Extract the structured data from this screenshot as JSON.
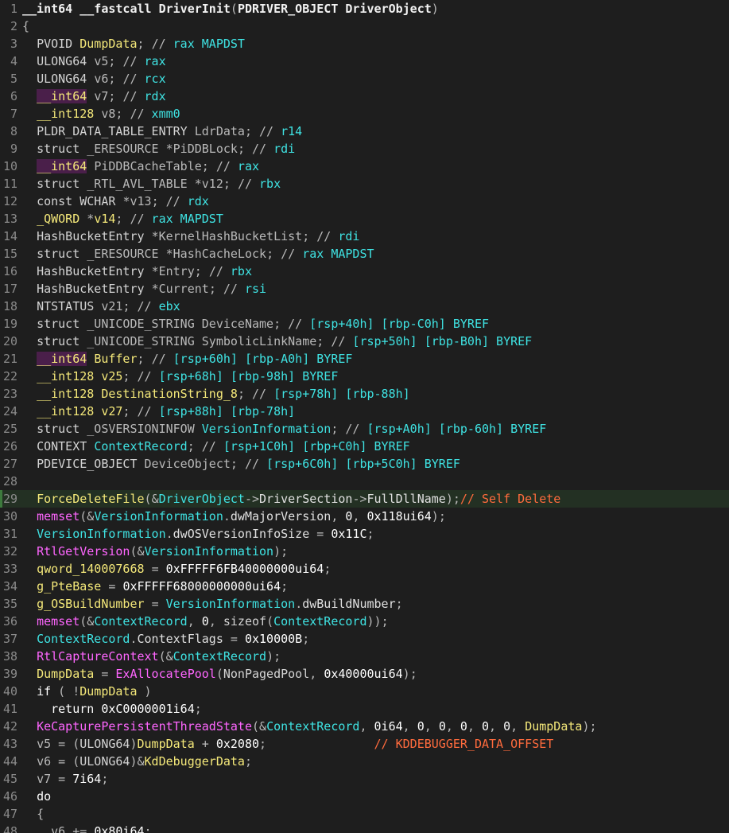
{
  "editor": {
    "colors": {
      "background": "#1e1e1e",
      "line_number": "#8a8a8a",
      "comment": "#ff6b3d",
      "register": "#3fe3e3",
      "library_function": "#ff66ff",
      "variable": "#f5e97a",
      "highlight_line": "#233023"
    },
    "lines": [
      {
        "n": "1",
        "code": "__int64 __fastcall DriverInit(PDRIVER_OBJECT DriverObject)"
      },
      {
        "n": "2",
        "code": "{"
      },
      {
        "n": "3",
        "code": "  PVOID DumpData; // rax MAPDST"
      },
      {
        "n": "4",
        "code": "  ULONG64 v5; // rax"
      },
      {
        "n": "5",
        "code": "  ULONG64 v6; // rcx"
      },
      {
        "n": "6",
        "code": "  __int64 v7; // rdx"
      },
      {
        "n": "7",
        "code": "  __int128 v8; // xmm0"
      },
      {
        "n": "8",
        "code": "  PLDR_DATA_TABLE_ENTRY LdrData; // r14"
      },
      {
        "n": "9",
        "code": "  struct _ERESOURCE *PiDDBLock; // rdi"
      },
      {
        "n": "10",
        "code": "  __int64 PiDDBCacheTable; // rax"
      },
      {
        "n": "11",
        "code": "  struct _RTL_AVL_TABLE *v12; // rbx"
      },
      {
        "n": "12",
        "code": "  const WCHAR *v13; // rdx"
      },
      {
        "n": "13",
        "code": "  _QWORD *v14; // rax MAPDST"
      },
      {
        "n": "14",
        "code": "  HashBucketEntry *KernelHashBucketList; // rdi"
      },
      {
        "n": "15",
        "code": "  struct _ERESOURCE *HashCacheLock; // rax MAPDST"
      },
      {
        "n": "16",
        "code": "  HashBucketEntry *Entry; // rbx"
      },
      {
        "n": "17",
        "code": "  HashBucketEntry *Current; // rsi"
      },
      {
        "n": "18",
        "code": "  NTSTATUS v21; // ebx"
      },
      {
        "n": "19",
        "code": "  struct _UNICODE_STRING DeviceName; // [rsp+40h] [rbp-C0h] BYREF"
      },
      {
        "n": "20",
        "code": "  struct _UNICODE_STRING SymbolicLinkName; // [rsp+50h] [rbp-B0h] BYREF"
      },
      {
        "n": "21",
        "code": "  __int64 Buffer; // [rsp+60h] [rbp-A0h] BYREF"
      },
      {
        "n": "22",
        "code": "  __int128 v25; // [rsp+68h] [rbp-98h] BYREF"
      },
      {
        "n": "23",
        "code": "  __int128 DestinationString_8; // [rsp+78h] [rbp-88h]"
      },
      {
        "n": "24",
        "code": "  __int128 v27; // [rsp+88h] [rbp-78h]"
      },
      {
        "n": "25",
        "code": "  struct _OSVERSIONINFOW VersionInformation; // [rsp+A0h] [rbp-60h] BYREF"
      },
      {
        "n": "26",
        "code": "  CONTEXT ContextRecord; // [rsp+1C0h] [rbp+C0h] BYREF"
      },
      {
        "n": "27",
        "code": "  PDEVICE_OBJECT DeviceObject; // [rsp+6C0h] [rbp+5C0h] BYREF"
      },
      {
        "n": "28",
        "code": ""
      },
      {
        "n": "29",
        "code": "  ForceDeleteFile(&DriverObject->DriverSection->FullDllName);// Self Delete"
      },
      {
        "n": "30",
        "code": "  memset(&VersionInformation.dwMajorVersion, 0, 0x118ui64);"
      },
      {
        "n": "31",
        "code": "  VersionInformation.dwOSVersionInfoSize = 0x11C;"
      },
      {
        "n": "32",
        "code": "  RtlGetVersion(&VersionInformation);"
      },
      {
        "n": "33",
        "code": "  qword_140007668 = 0xFFFFF6FB40000000ui64;"
      },
      {
        "n": "34",
        "code": "  g_PteBase = 0xFFFFF68000000000ui64;"
      },
      {
        "n": "35",
        "code": "  g_OSBuildNumber = VersionInformation.dwBuildNumber;"
      },
      {
        "n": "36",
        "code": "  memset(&ContextRecord, 0, sizeof(ContextRecord));"
      },
      {
        "n": "37",
        "code": "  ContextRecord.ContextFlags = 0x10000B;"
      },
      {
        "n": "38",
        "code": "  RtlCaptureContext(&ContextRecord);"
      },
      {
        "n": "39",
        "code": "  DumpData = ExAllocatePool(NonPagedPool, 0x40000ui64);"
      },
      {
        "n": "40",
        "code": "  if ( !DumpData )"
      },
      {
        "n": "41",
        "code": "    return 0xC0000001i64;"
      },
      {
        "n": "42",
        "code": "  KeCapturePersistentThreadState(&ContextRecord, 0i64, 0, 0, 0, 0, 0, DumpData);"
      },
      {
        "n": "43",
        "code": "  v5 = (ULONG64)DumpData + 0x2080;               // KDDEBUGGER_DATA_OFFSET"
      },
      {
        "n": "44",
        "code": "  v6 = (ULONG64)&KdDebuggerData;"
      },
      {
        "n": "45",
        "code": "  v7 = 7i64;"
      },
      {
        "n": "46",
        "code": "  do"
      },
      {
        "n": "47",
        "code": "  {"
      },
      {
        "n": "48",
        "code": "    v6 += 0x80i64;"
      }
    ]
  }
}
